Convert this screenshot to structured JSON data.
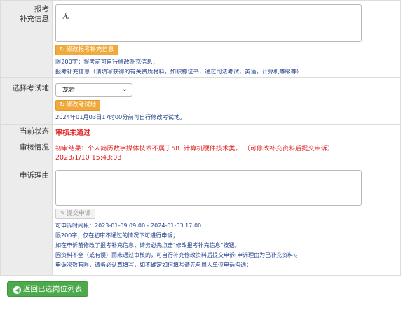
{
  "supplement": {
    "label_line1": "报考",
    "label_line2": "补充信息",
    "textarea_value": "无",
    "button_label": "修改报考补充信息",
    "note1": "限200字；报考前可自行修改补充信息；",
    "note2": "报考补充信息（请填写获得的有关资质材料，如职称证书，通过司法考试，英语，计算机等级等）"
  },
  "exam_location": {
    "label": "选择考试地",
    "selected": "龙岩",
    "button_label": "修改考试地",
    "note": "2024年01月03日17时00分前可自行修改考试地。"
  },
  "status": {
    "label": "当前状态",
    "value": "审核未通过"
  },
  "review": {
    "label": "审核情况",
    "result_text": "初审结果：个人简历数字媒体技术不属于58. 计算机硬件技术类。   （可修改补充资料后提交申诉）",
    "timestamp": "2023/1/10 15:43:03"
  },
  "appeal": {
    "label": "申诉理由",
    "textarea_value": "",
    "submit_label": "提交申诉",
    "notes": [
      "可申诉时间段：2023-01-09 09:00 - 2024-01-03 17:00",
      "限200字；仅在初审不通过的情况下可进行申诉；",
      "如在申诉前修改了报考补充信息，请务必先点击\"修改报考补充信息\"按钮。",
      "因资料不全（或有误）而未通过审核的，可自行补充修改资料后提交申诉(申诉理由为已补充资料)。",
      "申诉次数有限，请务必认真填写，如不确定如何填写请先与用人单位电话沟通；"
    ]
  },
  "back_button": {
    "label": "返回已选岗位列表"
  },
  "colors": {
    "orange_button": "#f0a93a",
    "green_button": "#4caa4c",
    "status_red": "#e02424",
    "note_blue": "#1f3f8a",
    "label_bg": "#ececec"
  }
}
